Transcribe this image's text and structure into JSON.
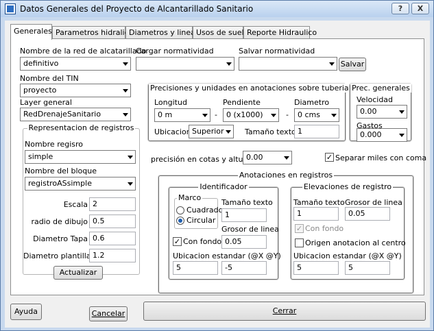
{
  "window": {
    "title": "Datos Generales del Proyecto de Alcantarillado Sanitario",
    "help_btn": "?",
    "close_btn": "X"
  },
  "tabs": [
    {
      "label": "Generales"
    },
    {
      "label": "Parametros hidralica"
    },
    {
      "label": "Diametros y lineas"
    },
    {
      "label": "Usos de suelo"
    },
    {
      "label": "Reporte Hidraulico"
    }
  ],
  "red": {
    "label": "Nombre de la red de alcatarillado",
    "value": "definitivo"
  },
  "cargar": {
    "label": "Cargar normatividad",
    "value": ""
  },
  "salvar": {
    "label": "Salvar normatividad",
    "value": "",
    "button": "Salvar"
  },
  "tin": {
    "label": "Nombre del TIN",
    "value": "proyecto"
  },
  "layer": {
    "label": "Layer general",
    "value": "RedDrenajeSanitario"
  },
  "registros": {
    "title": "Representacion de registros",
    "nombre_label": "Nombre regisro",
    "nombre_value": "simple",
    "bloque_label": "Nombre del bloque",
    "bloque_value": "registroASsimple",
    "escala_label": "Escala",
    "escala_value": "2",
    "radio_label": "radio de dibujo",
    "radio_value": "0.5",
    "tapa_label": "Diametro Tapa",
    "tapa_value": "0.6",
    "plantilla_label": "Diametro plantilla",
    "plantilla_value": "1.2",
    "actualizar": "Actualizar"
  },
  "precisiones": {
    "title": "Precisiones y unidades en anotaciones sobre tuberia",
    "longitud_label": "Longitud",
    "longitud_value": "0 m",
    "pendiente_label": "Pendiente",
    "pendiente_value": "0 (x1000)",
    "diametro_label": "Diametro",
    "diametro_value": "0 cms",
    "sep": "-",
    "ubicacion_label": "Ubicacion",
    "ubicacion_value": "Superior",
    "tamano_label": "Tamaño texto",
    "tamano_value": "1"
  },
  "prec_generales": {
    "title": "Prec. generales",
    "velocidad_label": "Velocidad",
    "velocidad_value": "0.00",
    "gastos_label": "Gastos",
    "gastos_value": "0.000"
  },
  "cotas": {
    "label": "precisión en cotas y alturas",
    "value": "0.00"
  },
  "separar": {
    "label": "Separar miles con coma",
    "checked": true
  },
  "anotaciones": {
    "title": "Anotaciones en registros",
    "ident": {
      "title": "Identificador",
      "marco_title": "Marco",
      "cuadrado": "Cuadrado",
      "circular": "Circular",
      "tamano_label": "Tamaño texto",
      "tamano_value": "1",
      "grosor_label": "Grosor de linea",
      "grosor_value": "0.05",
      "confondo_label": "Con fondo",
      "ubic_label": "Ubicacion estandar (@X @Y)",
      "ubic_x": "5",
      "ubic_y": "-5"
    },
    "elev": {
      "title": "Elevaciones de registro",
      "tamano_label": "Tamaño texto",
      "tamano_value": "1",
      "grosor_label": "Grosor de linea",
      "grosor_value": "0.05",
      "confondo_label": "Con fondo",
      "origen_label": "Origen anotacion al centro",
      "ubic_label": "Ubicacion estandar (@X @Y)",
      "ubic_x": "5",
      "ubic_y": "5"
    }
  },
  "footer": {
    "ayuda": "Ayuda",
    "cancelar": "Cancelar",
    "cerrar": "Cerrar"
  }
}
